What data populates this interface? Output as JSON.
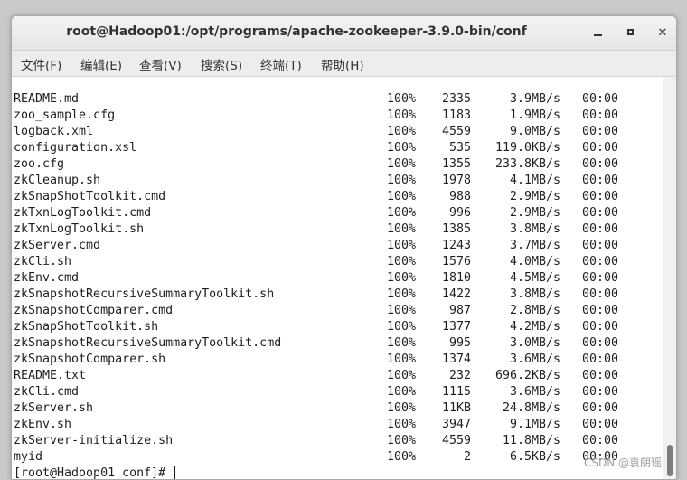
{
  "window": {
    "title": "root@Hadoop01:/opt/programs/apache-zookeeper-3.9.0-bin/conf"
  },
  "menu": {
    "items": [
      {
        "label": "文件(F)"
      },
      {
        "label": "编辑(E)"
      },
      {
        "label": "查看(V)"
      },
      {
        "label": "搜索(S)"
      },
      {
        "label": "终端(T)"
      },
      {
        "label": "帮助(H)"
      }
    ]
  },
  "terminal": {
    "rows": [
      {
        "name": "README.md",
        "pct": "100%",
        "size": "2335",
        "rate": "3.9MB/s",
        "time": "00:00"
      },
      {
        "name": "zoo_sample.cfg",
        "pct": "100%",
        "size": "1183",
        "rate": "1.9MB/s",
        "time": "00:00"
      },
      {
        "name": "logback.xml",
        "pct": "100%",
        "size": "4559",
        "rate": "9.0MB/s",
        "time": "00:00"
      },
      {
        "name": "configuration.xsl",
        "pct": "100%",
        "size": "535",
        "rate": "119.0KB/s",
        "time": "00:00"
      },
      {
        "name": "zoo.cfg",
        "pct": "100%",
        "size": "1355",
        "rate": "233.8KB/s",
        "time": "00:00"
      },
      {
        "name": "zkCleanup.sh",
        "pct": "100%",
        "size": "1978",
        "rate": "4.1MB/s",
        "time": "00:00"
      },
      {
        "name": "zkSnapShotToolkit.cmd",
        "pct": "100%",
        "size": "988",
        "rate": "2.9MB/s",
        "time": "00:00"
      },
      {
        "name": "zkTxnLogToolkit.cmd",
        "pct": "100%",
        "size": "996",
        "rate": "2.9MB/s",
        "time": "00:00"
      },
      {
        "name": "zkTxnLogToolkit.sh",
        "pct": "100%",
        "size": "1385",
        "rate": "3.8MB/s",
        "time": "00:00"
      },
      {
        "name": "zkServer.cmd",
        "pct": "100%",
        "size": "1243",
        "rate": "3.7MB/s",
        "time": "00:00"
      },
      {
        "name": "zkCli.sh",
        "pct": "100%",
        "size": "1576",
        "rate": "4.0MB/s",
        "time": "00:00"
      },
      {
        "name": "zkEnv.cmd",
        "pct": "100%",
        "size": "1810",
        "rate": "4.5MB/s",
        "time": "00:00"
      },
      {
        "name": "zkSnapshotRecursiveSummaryToolkit.sh",
        "pct": "100%",
        "size": "1422",
        "rate": "3.8MB/s",
        "time": "00:00"
      },
      {
        "name": "zkSnapshotComparer.cmd",
        "pct": "100%",
        "size": "987",
        "rate": "2.8MB/s",
        "time": "00:00"
      },
      {
        "name": "zkSnapShotToolkit.sh",
        "pct": "100%",
        "size": "1377",
        "rate": "4.2MB/s",
        "time": "00:00"
      },
      {
        "name": "zkSnapshotRecursiveSummaryToolkit.cmd",
        "pct": "100%",
        "size": "995",
        "rate": "3.0MB/s",
        "time": "00:00"
      },
      {
        "name": "zkSnapshotComparer.sh",
        "pct": "100%",
        "size": "1374",
        "rate": "3.6MB/s",
        "time": "00:00"
      },
      {
        "name": "README.txt",
        "pct": "100%",
        "size": "232",
        "rate": "696.2KB/s",
        "time": "00:00"
      },
      {
        "name": "zkCli.cmd",
        "pct": "100%",
        "size": "1115",
        "rate": "3.6MB/s",
        "time": "00:00"
      },
      {
        "name": "zkServer.sh",
        "pct": "100%",
        "size": "11KB",
        "rate": "24.8MB/s",
        "time": "00:00"
      },
      {
        "name": "zkEnv.sh",
        "pct": "100%",
        "size": "3947",
        "rate": "9.1MB/s",
        "time": "00:00"
      },
      {
        "name": "zkServer-initialize.sh",
        "pct": "100%",
        "size": "4559",
        "rate": "11.8MB/s",
        "time": "00:00"
      },
      {
        "name": "myid",
        "pct": "100%",
        "size": "2",
        "rate": "6.5KB/s",
        "time": "00:00"
      }
    ],
    "prompt": "[root@Hadoop01 conf]# "
  },
  "watermark": "CSDN @袁朗瑶"
}
